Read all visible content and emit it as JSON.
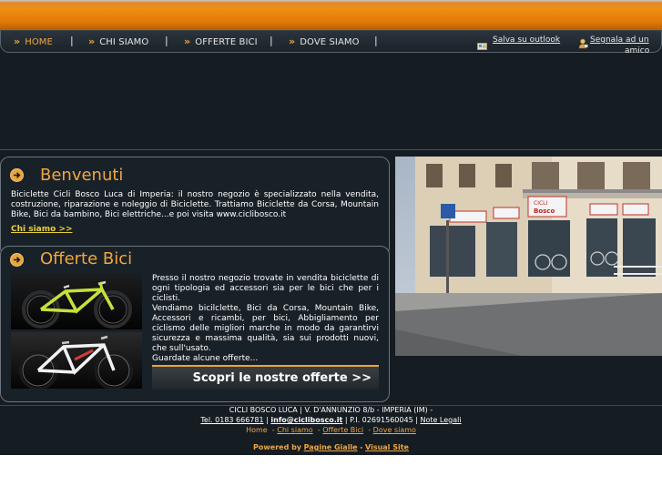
{
  "nav": {
    "items": [
      {
        "label": "HOME",
        "active": true
      },
      {
        "label": "CHI SIAMO",
        "active": false
      },
      {
        "label": "OFFERTE BICI",
        "active": false
      },
      {
        "label": "DOVE SIAMO",
        "active": false
      }
    ],
    "separator": "|",
    "chevron": "»",
    "save_outlook": "Salva su outlook",
    "recommend_line1": "Segnala ad un",
    "recommend_line2": "amico"
  },
  "welcome": {
    "title": "Benvenuti",
    "text": "Biciclette Cicli Bosco Luca di Imperia: il nostro negozio è specializzato nella vendita, costruzione, riparazione e noleggio di Biciclette. Trattiamo Biciclette da Corsa, Mountain Bike, Bici da bambino, Bici elettriche...e poi visita  www.ciclibosco.it",
    "link": "Chi siamo >>"
  },
  "offers": {
    "title": "Offerte Bici",
    "text": "Presso il nostro negozio trovate in vendita biciclette di ogni tipologia ed accessori sia per le bici che per i ciclisti.\nVendiamo bicilclette, Bici da Corsa, Mountain Bike, Accessori e ricambi, per bici, Abbigliamento per ciclismo delle migliori marche in modo da garantirvi sicurezza e massima qualità, sia sui prodotti nuovi, che sull'usato.\nGuardate alcune offerte...",
    "cta": "Scopri le nostre offerte >>"
  },
  "photo": {
    "sign_text": "CICLI Bosco"
  },
  "footer": {
    "line1": "CICLI BOSCO LUCA | V. D'ANNUNZIO 8/b - IMPERIA (IM) -",
    "tel": "Tel. 0183 666781",
    "email": "info@ciclibosco.it",
    "piva": "| P.I. 02691560045 |",
    "legal": "Note Legali",
    "links": [
      "Home",
      "Chi siamo",
      "Offerte Bici",
      "Dove siamo"
    ],
    "powered_by": "Powered by",
    "pagine_gialle": "Pagine Gialle",
    "visual_site": "Visual Site"
  },
  "colors": {
    "accent": "#f0a640",
    "header_orange": "#ef8e12",
    "background": "#151c22",
    "link_yellow": "#e8d040"
  }
}
